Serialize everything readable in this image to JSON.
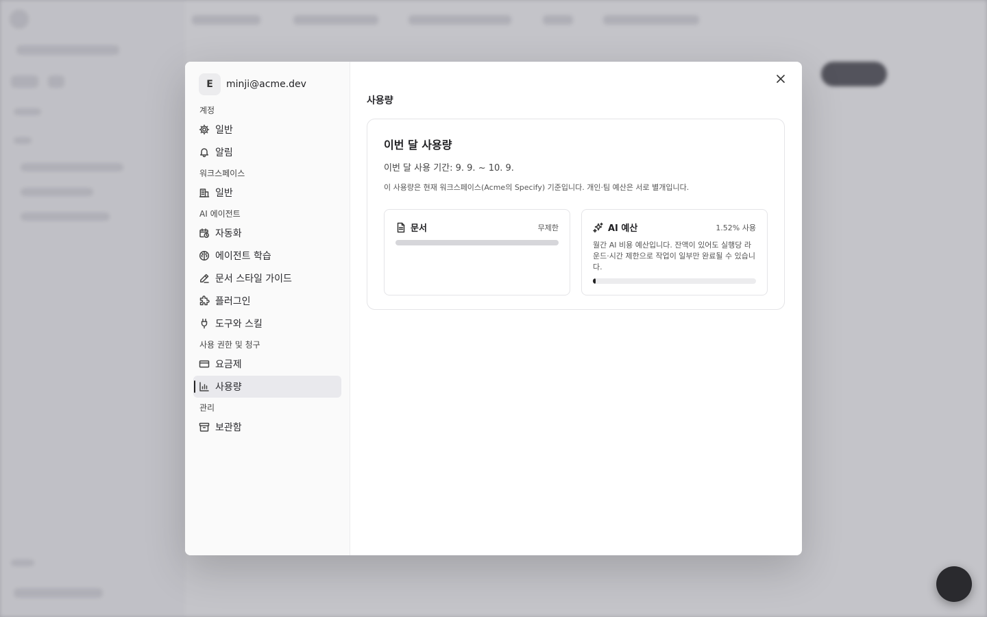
{
  "account": {
    "avatar_letter": "E",
    "email": "minji@acme.dev"
  },
  "sidebar": {
    "sections": [
      {
        "label": "계정",
        "items": [
          {
            "label": "일반",
            "icon": "gear-icon"
          },
          {
            "label": "알림",
            "icon": "bell-icon"
          }
        ]
      },
      {
        "label": "워크스페이스",
        "items": [
          {
            "label": "일반",
            "icon": "building-icon"
          }
        ]
      },
      {
        "label": "AI 에이전트",
        "items": [
          {
            "label": "자동화",
            "icon": "calendar-clock-icon"
          },
          {
            "label": "에이전트 학습",
            "icon": "brain-icon"
          },
          {
            "label": "문서 스타일 가이드",
            "icon": "pen-icon"
          },
          {
            "label": "플러그인",
            "icon": "puzzle-icon"
          },
          {
            "label": "도구와 스킬",
            "icon": "plug-icon"
          }
        ]
      },
      {
        "label": "사용 권한 및 청구",
        "items": [
          {
            "label": "요금제",
            "icon": "credit-card-icon"
          },
          {
            "label": "사용량",
            "icon": "bar-chart-icon",
            "active": true
          }
        ]
      },
      {
        "label": "관리",
        "items": [
          {
            "label": "보관함",
            "icon": "archive-icon"
          }
        ]
      }
    ]
  },
  "main": {
    "title": "사용량",
    "card": {
      "title": "이번 달 사용량",
      "period": "이번 달 사용 기간: 9. 9. ~ 10. 9.",
      "note": "이 사용량은 현재 워크스페이스(Acme의 Specify) 기준입니다. 개인·팀 예산은 서로 별개입니다.",
      "docs": {
        "label": "문서",
        "meta": "무제한",
        "icon": "document-icon"
      },
      "ai": {
        "label": "AI 예산",
        "meta": "1.52% 사용",
        "usage_fraction": 0.0152,
        "icon": "sparkles-icon",
        "description": "월간 AI 비용 예산입니다. 잔액이 있어도 실행당 라운드·시간 제한으로 작업이 일부만 완료될 수 있습니다."
      }
    }
  },
  "colors": {
    "overlay": "#8a8a94",
    "accent": "#222222",
    "active_bg": "#e9e9ed"
  }
}
